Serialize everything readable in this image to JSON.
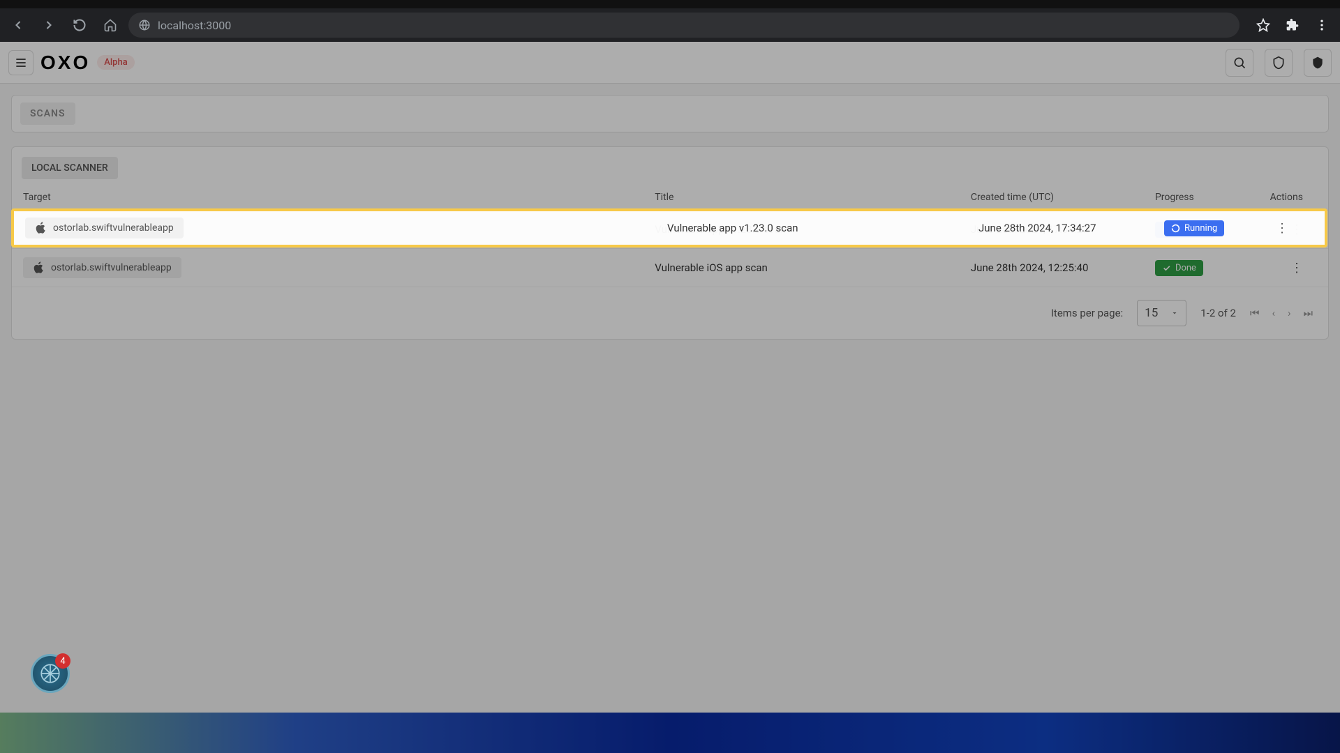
{
  "browser": {
    "url": "localhost:3000"
  },
  "header": {
    "logo": "OXO",
    "badge": "Alpha"
  },
  "scans": {
    "button": "SCANS"
  },
  "table": {
    "chip": "LOCAL SCANNER",
    "columns": {
      "target": "Target",
      "title": "Title",
      "created": "Created time (UTC)",
      "progress": "Progress",
      "actions": "Actions"
    },
    "rows": [
      {
        "target": "ostorlab.swiftvulnerableapp",
        "title": "Vulnerable app v1.23.0 scan",
        "created": "June 28th 2024, 17:34:27",
        "progress_label": "Running",
        "progress_kind": "running"
      },
      {
        "target": "ostorlab.swiftvulnerableapp",
        "title": "Vulnerable iOS app scan",
        "created": "June 28th 2024, 12:25:40",
        "progress_label": "Done",
        "progress_kind": "done"
      }
    ]
  },
  "pagination": {
    "items_label": "Items per page:",
    "per_page": "15",
    "range": "1-2 of 2"
  },
  "float_badge_count": "4"
}
